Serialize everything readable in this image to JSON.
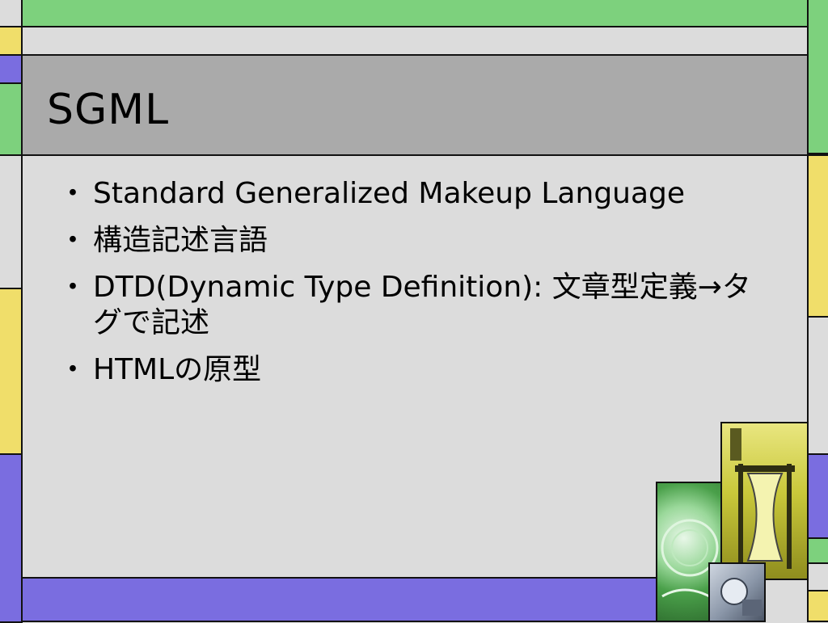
{
  "slide": {
    "title": "SGML",
    "bullet_marker": "・",
    "bullets": [
      {
        "text": "Standard Generalized Makeup Language"
      },
      {
        "text": "構造記述言語"
      },
      {
        "text": "DTD(Dynamic Type Definition): 文章型定義→タグで記述"
      },
      {
        "text": "HTMLの原型"
      }
    ]
  },
  "colors": {
    "green": "#7dd17d",
    "yellow": "#f0de6a",
    "purple": "#7a6de0",
    "background": "#dcdcdc",
    "title_band": "#aaaaaa"
  }
}
